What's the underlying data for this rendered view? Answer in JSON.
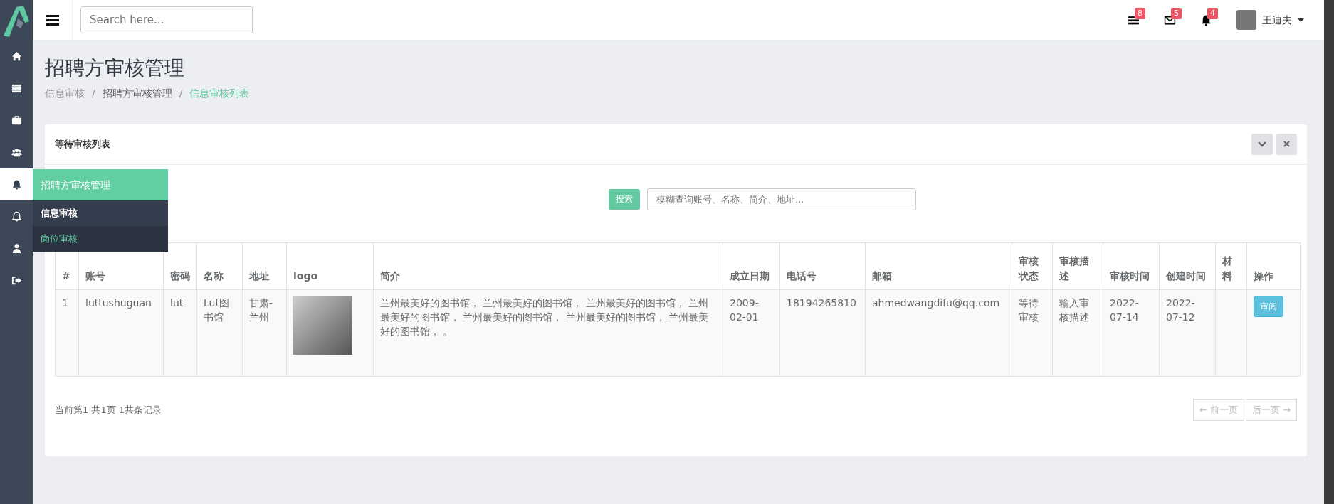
{
  "sidebar": {
    "items": [
      {
        "kind": "home",
        "selected": false
      },
      {
        "kind": "server",
        "selected": false
      },
      {
        "kind": "briefcase",
        "selected": false
      },
      {
        "kind": "users",
        "selected": false
      },
      {
        "kind": "bell",
        "selected": true
      },
      {
        "kind": "bellOutline",
        "selected": false
      },
      {
        "kind": "user",
        "selected": false
      },
      {
        "kind": "signout",
        "selected": false
      }
    ]
  },
  "flyout": {
    "title": "招聘方审核管理",
    "items": [
      {
        "label": "信息审核",
        "selected": false
      },
      {
        "label": "岗位审核",
        "selected": true
      }
    ]
  },
  "header": {
    "search": {
      "placeholder": "Search here..."
    },
    "notifications": [
      {
        "kind": "tasks",
        "count": "8"
      },
      {
        "kind": "mail",
        "count": "5"
      },
      {
        "kind": "bell",
        "count": "4"
      }
    ],
    "user": {
      "name": "王迪夫"
    }
  },
  "page": {
    "title": "招聘方审核管理",
    "separator": "/",
    "breadcrumb": [
      {
        "label": "信息审核",
        "selected": false
      },
      {
        "label": "招聘方审核管理",
        "selected": false
      },
      {
        "label": "信息审核列表",
        "selected": true
      }
    ]
  },
  "card": {
    "title": "等待审核列表",
    "search_button": "搜索",
    "search_placeholder": "模糊查询账号、名称、简介、地址...",
    "table": {
      "columns": [
        {
          "label": "#",
          "kind": "text"
        },
        {
          "label": "账号",
          "kind": "text"
        },
        {
          "label": "密码",
          "kind": "text"
        },
        {
          "label": "名称",
          "kind": "text"
        },
        {
          "label": "地址",
          "kind": "text"
        },
        {
          "label": "logo",
          "kind": "image"
        },
        {
          "label": "简介",
          "kind": "text"
        },
        {
          "label": "成立日期",
          "kind": "text"
        },
        {
          "label": "电话号",
          "kind": "text"
        },
        {
          "label": "邮箱",
          "kind": "text"
        },
        {
          "label": "审核状态",
          "kind": "text"
        },
        {
          "label": "审核描述",
          "kind": "text"
        },
        {
          "label": "审核时间",
          "kind": "text"
        },
        {
          "label": "创建时间",
          "kind": "text"
        },
        {
          "label": "材料",
          "kind": "blank"
        },
        {
          "label": "操作",
          "kind": "action"
        }
      ],
      "rows": [
        {
          "cells": [
            "1",
            "luttushuguan",
            "lut",
            "Lut图书馆",
            "甘肃-兰州",
            "",
            "兰州最美好的图书馆， 兰州最美好的图书馆， 兰州最美好的图书馆， 兰州最美好的图书馆， 兰州最美好的图书馆， 兰州最美好的图书馆， 兰州最美好的图书馆， 。",
            "2009-02-01",
            "18194265810",
            "ahmedwangdifu@qq.com",
            "等待审核",
            "输入审核描述",
            "2022-07-14",
            "2022-07-12",
            "",
            "审阅"
          ]
        }
      ]
    },
    "footer": "当前第1 共1页 1共条记录",
    "pager": [
      {
        "label": "← 前一页",
        "disabled": true
      },
      {
        "label": "后一页 →",
        "disabled": true
      }
    ]
  }
}
